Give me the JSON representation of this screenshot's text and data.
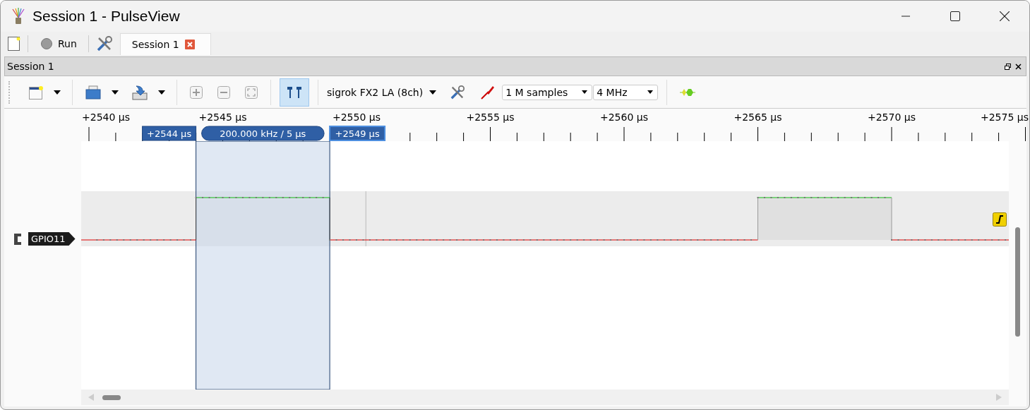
{
  "window": {
    "title": "Session 1 - PulseView"
  },
  "main_toolbar": {
    "run_button": "Run"
  },
  "tabs": [
    {
      "label": "Session 1",
      "selected": true
    }
  ],
  "dock": {
    "title": "Session 1"
  },
  "toolbar": {
    "cursor_toggle": {
      "on": true
    },
    "device": "sigrok FX2 LA (8ch)",
    "sample_count": "1 M samples",
    "sample_rate": "4 MHz"
  },
  "ruler": {
    "labels": [
      "+2540 µs",
      "+2545 µs",
      "+2550 µs",
      "+2555 µs",
      "+2560 µs",
      "+2565 µs",
      "+2570 µs",
      "+2575 µs"
    ]
  },
  "cursors": {
    "start": "+2544 µs",
    "span": "200.000 kHz / 5 µs",
    "end": "+2549 µs"
  },
  "channels": [
    {
      "name": "GPIO11",
      "rising_edge_trigger": true
    }
  ]
}
